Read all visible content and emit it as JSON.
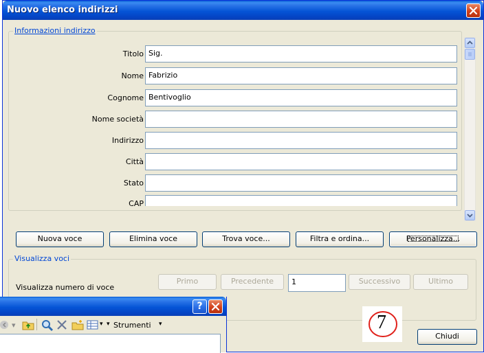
{
  "dialog": {
    "title": "Nuovo elenco indirizzi",
    "address_group": "Informazioni indirizzo",
    "fields": [
      {
        "label": "Titolo",
        "value": "Sig."
      },
      {
        "label": "Nome",
        "value": "Fabrizio"
      },
      {
        "label": "Cognome",
        "value": "Bentivoglio"
      },
      {
        "label": "Nome società",
        "value": ""
      },
      {
        "label": "Indirizzo",
        "value": ""
      },
      {
        "label": "Città",
        "value": ""
      },
      {
        "label": "Stato",
        "value": ""
      },
      {
        "label": "CAP",
        "value": ""
      }
    ],
    "buttons": {
      "new_entry": "Nuova voce",
      "delete_entry": "Elimina voce",
      "find_entry": "Trova voce...",
      "filter_sort": "Filtra e ordina...",
      "customize": "Personalizza..."
    },
    "view_group": "Visualizza voci",
    "view_label": "Visualizza numero di voce",
    "nav": {
      "first": "Primo",
      "previous": "Precedente",
      "current": "1",
      "next": "Successivo",
      "last": "Ultimo"
    },
    "close": "Chiudi",
    "step_marker": "7"
  },
  "second_window": {
    "help_label": "?",
    "tools_menu": "Strumenti"
  },
  "colors": {
    "titlebar": "#0554d6",
    "dialog_bg": "#ece9d8",
    "legend_text": "#0046d5",
    "close_button": "#d2401a",
    "marker_red": "#e0201a"
  },
  "icons": [
    "close-icon",
    "scroll-up-icon",
    "scroll-down-icon",
    "help-icon",
    "back-icon",
    "folder-up-icon",
    "search-icon",
    "delete-icon",
    "new-folder-icon",
    "views-icon"
  ]
}
